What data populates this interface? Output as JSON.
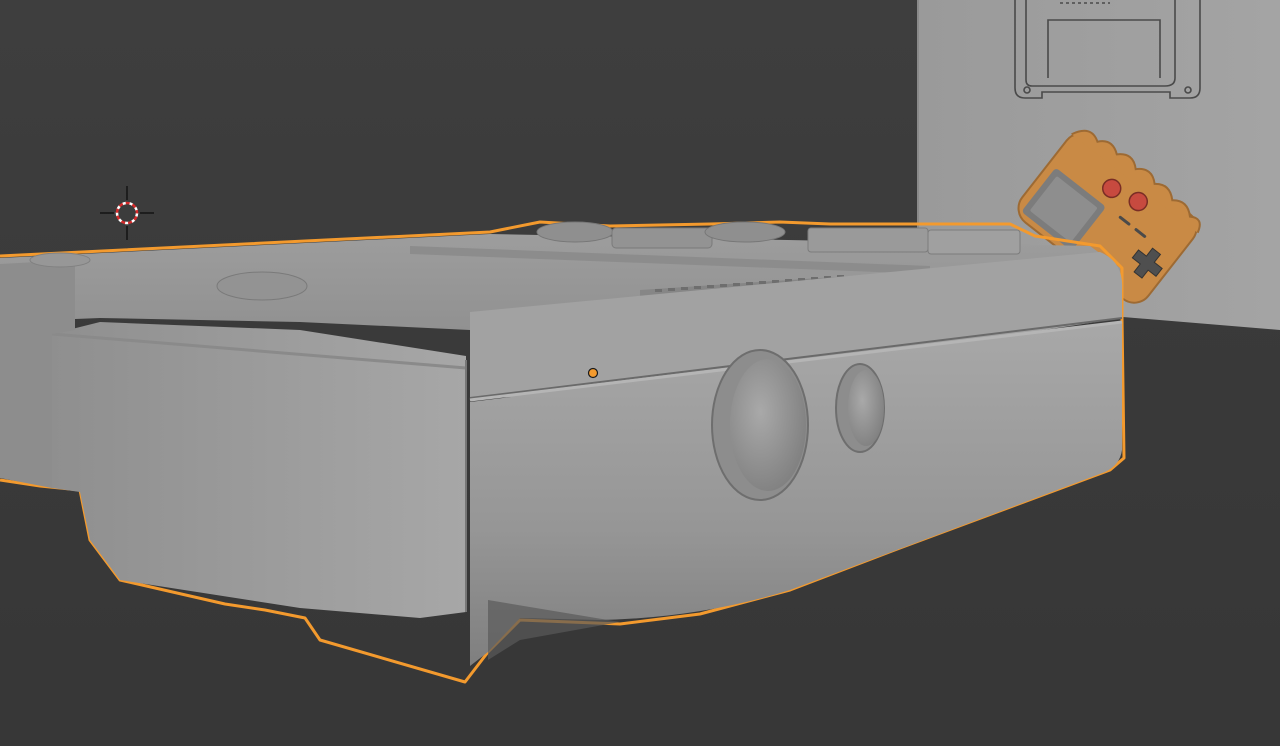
{
  "app": {
    "viewport": "3d-viewport",
    "mode": "object-mode",
    "shading": "solid"
  },
  "scene": {
    "selected_object": "handheld-console-body",
    "objects": [
      {
        "name": "handheld-console-body",
        "selected": true
      },
      {
        "name": "reference-image-plane",
        "selected": false
      },
      {
        "name": "orange-controller-model",
        "selected": false
      }
    ]
  },
  "icons": {
    "cursor": "3d-cursor-icon",
    "origin": "object-origin-icon"
  },
  "colors": {
    "background": "#3d3d3d",
    "floor": "#353535",
    "selection_outline": "#f39a2e",
    "model_gray": "#9a9a9a",
    "reference_plane": "#a0a0a0",
    "controller_orange": "#c98a45",
    "controller_button_red": "#c74a3f"
  }
}
